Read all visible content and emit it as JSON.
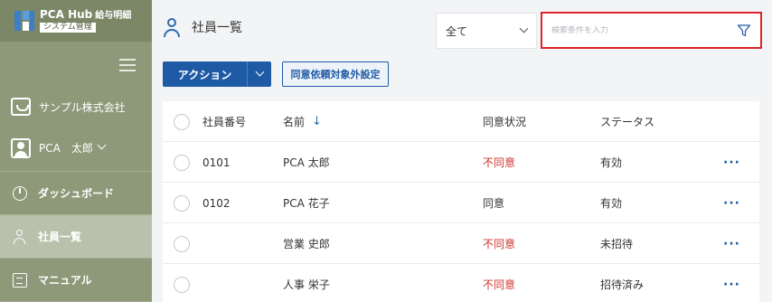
{
  "app": {
    "logo_main": "PCA Hub",
    "logo_suffix": "給与明細",
    "logo_sub": "システム管理"
  },
  "sidebar": {
    "company": "サンプル株式会社",
    "user": "PCA　太郎",
    "items": [
      {
        "label": "ダッシュボード",
        "icon": "dashboard-icon"
      },
      {
        "label": "社員一覧",
        "icon": "person-icon",
        "active": true
      },
      {
        "label": "マニュアル",
        "icon": "manual-icon"
      }
    ]
  },
  "header": {
    "title": "社員一覧",
    "filter_value": "全て",
    "search_placeholder": "検索条件を入力",
    "action_label": "アクション",
    "exclude_button": "同意依頼対象外設定"
  },
  "table": {
    "columns": [
      "社員番号",
      "名前",
      "同意状況",
      "ステータス"
    ],
    "sort_indicator": "↓",
    "rows": [
      {
        "num": "0101",
        "name": "PCA 太郎",
        "consent": "不同意",
        "status": "有効"
      },
      {
        "num": "0102",
        "name": "PCA 花子",
        "consent": "同意",
        "status": "有効"
      },
      {
        "num": "",
        "name": "営業 史郎",
        "consent": "不同意",
        "status": "未招待"
      },
      {
        "num": "",
        "name": "人事 栄子",
        "consent": "不同意",
        "status": "招待済み"
      }
    ],
    "more_label": "···"
  },
  "colors": {
    "sidebar": "#8e9979",
    "primary": "#1f5aa6",
    "alert": "#d0362f",
    "highlight_border": "#e0242b"
  }
}
